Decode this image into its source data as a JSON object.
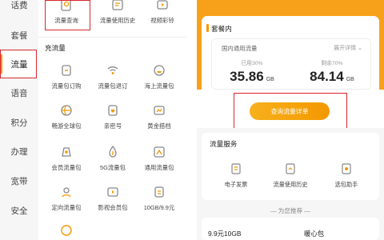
{
  "categories": [
    "话费",
    "套餐",
    "流量",
    "语音",
    "积分",
    "办理",
    "宽带",
    "安全"
  ],
  "top_row": [
    "流量查询",
    "流量使用历史",
    "视频彩铃"
  ],
  "section_title": "充流量",
  "grid": [
    [
      "流量包订购",
      "流量包退订",
      "海上流量包"
    ],
    [
      "畅游全球包",
      "亲密号",
      "黄金搭档"
    ],
    [
      "会员流量包",
      "5G流量包",
      "通用流量包"
    ],
    [
      "定向流量包",
      "影视会员包",
      "10GB/9.9元"
    ]
  ],
  "right": {
    "package_title": "套餐内",
    "national_label": "国内通用流量",
    "expand_label": "展开详情",
    "used_label": "已用30%",
    "used_value": "35.86",
    "remain_label": "剩余70%",
    "remain_value": "84.14",
    "unit": "GB",
    "query_button": "查询流量详单",
    "service_title": "流量服务",
    "services": [
      "电子发票",
      "流量使用历史",
      "选包助手"
    ],
    "recommend": "— 为您推荐 —",
    "promo1": "9.9元10GB",
    "promo2": "暖心包"
  },
  "colors": {
    "accent": "#f39800",
    "highlight": "#d9262c"
  }
}
